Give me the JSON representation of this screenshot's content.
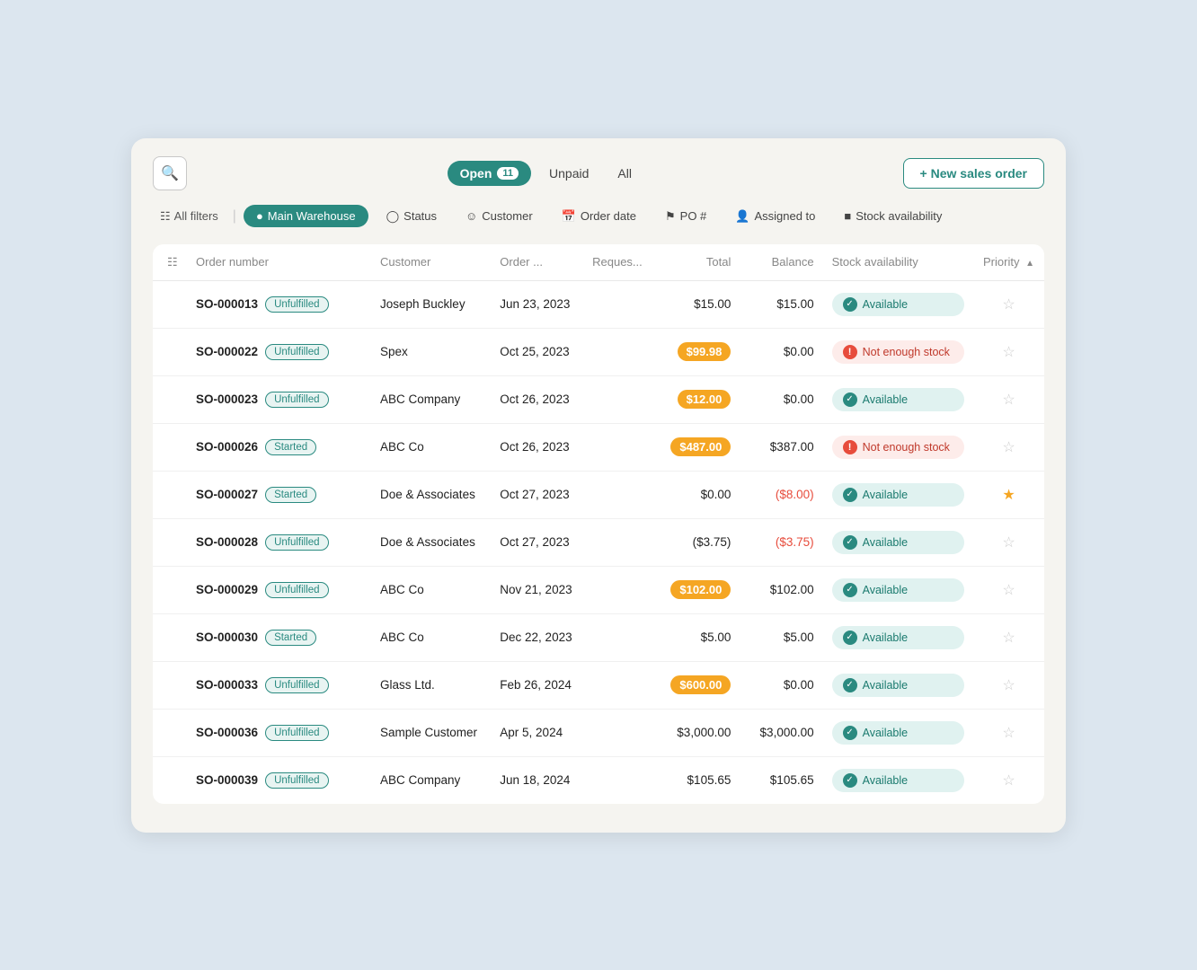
{
  "header": {
    "search_icon": "🔍",
    "tabs": [
      {
        "label": "Open",
        "badge": "11",
        "active": true
      },
      {
        "label": "Unpaid",
        "active": false
      },
      {
        "label": "All",
        "active": false
      }
    ],
    "new_order_btn": "+ New sales order"
  },
  "filters": {
    "all_filters": "All filters",
    "main_warehouse": "Main Warehouse",
    "status": "Status",
    "customer": "Customer",
    "order_date": "Order date",
    "po_num": "PO #",
    "assigned_to": "Assigned to",
    "stock_availability": "Stock availability"
  },
  "table": {
    "columns": [
      "Order number",
      "Customer",
      "Order ...",
      "Reques...",
      "Total",
      "Balance",
      "Stock availability",
      "Priority"
    ],
    "rows": [
      {
        "id": "SO-000013",
        "status": "Unfulfilled",
        "status_type": "unfulfilled",
        "customer": "Joseph Buckley",
        "order_date": "Jun 23, 2023",
        "request_date": "",
        "total": "$15.00",
        "total_highlighted": false,
        "balance": "$15.00",
        "balance_type": "pos",
        "stock": "Available",
        "stock_type": "available",
        "priority_starred": false
      },
      {
        "id": "SO-000022",
        "status": "Unfulfilled",
        "status_type": "unfulfilled",
        "customer": "Spex",
        "order_date": "Oct 25, 2023",
        "request_date": "",
        "total": "$99.98",
        "total_highlighted": true,
        "balance": "$0.00",
        "balance_type": "pos",
        "stock": "Not enough stock",
        "stock_type": "not-enough",
        "priority_starred": false
      },
      {
        "id": "SO-000023",
        "status": "Unfulfilled",
        "status_type": "unfulfilled",
        "customer": "ABC Company",
        "order_date": "Oct 26, 2023",
        "request_date": "",
        "total": "$12.00",
        "total_highlighted": true,
        "balance": "$0.00",
        "balance_type": "pos",
        "stock": "Available",
        "stock_type": "available",
        "priority_starred": false
      },
      {
        "id": "SO-000026",
        "status": "Started",
        "status_type": "started",
        "customer": "ABC Co",
        "order_date": "Oct 26, 2023",
        "request_date": "",
        "total": "$487.00",
        "total_highlighted": true,
        "balance": "$387.00",
        "balance_type": "pos",
        "stock": "Not enough stock",
        "stock_type": "not-enough",
        "priority_starred": false
      },
      {
        "id": "SO-000027",
        "status": "Started",
        "status_type": "started",
        "customer": "Doe & Associates",
        "order_date": "Oct 27, 2023",
        "request_date": "",
        "total": "$0.00",
        "total_highlighted": false,
        "balance": "($8.00)",
        "balance_type": "neg",
        "stock": "Available",
        "stock_type": "available",
        "priority_starred": true
      },
      {
        "id": "SO-000028",
        "status": "Unfulfilled",
        "status_type": "unfulfilled",
        "customer": "Doe & Associates",
        "order_date": "Oct 27, 2023",
        "request_date": "",
        "total": "($3.75)",
        "total_highlighted": false,
        "balance": "($3.75)",
        "balance_type": "neg",
        "stock": "Available",
        "stock_type": "available",
        "priority_starred": false
      },
      {
        "id": "SO-000029",
        "status": "Unfulfilled",
        "status_type": "unfulfilled",
        "customer": "ABC Co",
        "order_date": "Nov 21, 2023",
        "request_date": "",
        "total": "$102.00",
        "total_highlighted": true,
        "balance": "$102.00",
        "balance_type": "pos",
        "stock": "Available",
        "stock_type": "available",
        "priority_starred": false
      },
      {
        "id": "SO-000030",
        "status": "Started",
        "status_type": "started",
        "customer": "ABC Co",
        "order_date": "Dec 22, 2023",
        "request_date": "",
        "total": "$5.00",
        "total_highlighted": false,
        "balance": "$5.00",
        "balance_type": "pos",
        "stock": "Available",
        "stock_type": "available",
        "priority_starred": false
      },
      {
        "id": "SO-000033",
        "status": "Unfulfilled",
        "status_type": "unfulfilled",
        "customer": "Glass Ltd.",
        "order_date": "Feb 26, 2024",
        "request_date": "",
        "total": "$600.00",
        "total_highlighted": true,
        "balance": "$0.00",
        "balance_type": "pos",
        "stock": "Available",
        "stock_type": "available",
        "priority_starred": false
      },
      {
        "id": "SO-000036",
        "status": "Unfulfilled",
        "status_type": "unfulfilled",
        "customer": "Sample Customer",
        "order_date": "Apr 5, 2024",
        "request_date": "",
        "total": "$3,000.00",
        "total_highlighted": false,
        "balance": "$3,000.00",
        "balance_type": "pos",
        "stock": "Available",
        "stock_type": "available",
        "priority_starred": false
      },
      {
        "id": "SO-000039",
        "status": "Unfulfilled",
        "status_type": "unfulfilled",
        "customer": "ABC Company",
        "order_date": "Jun 18, 2024",
        "request_date": "",
        "total": "$105.65",
        "total_highlighted": false,
        "balance": "$105.65",
        "balance_type": "pos",
        "stock": "Available",
        "stock_type": "available",
        "priority_starred": false
      }
    ]
  }
}
